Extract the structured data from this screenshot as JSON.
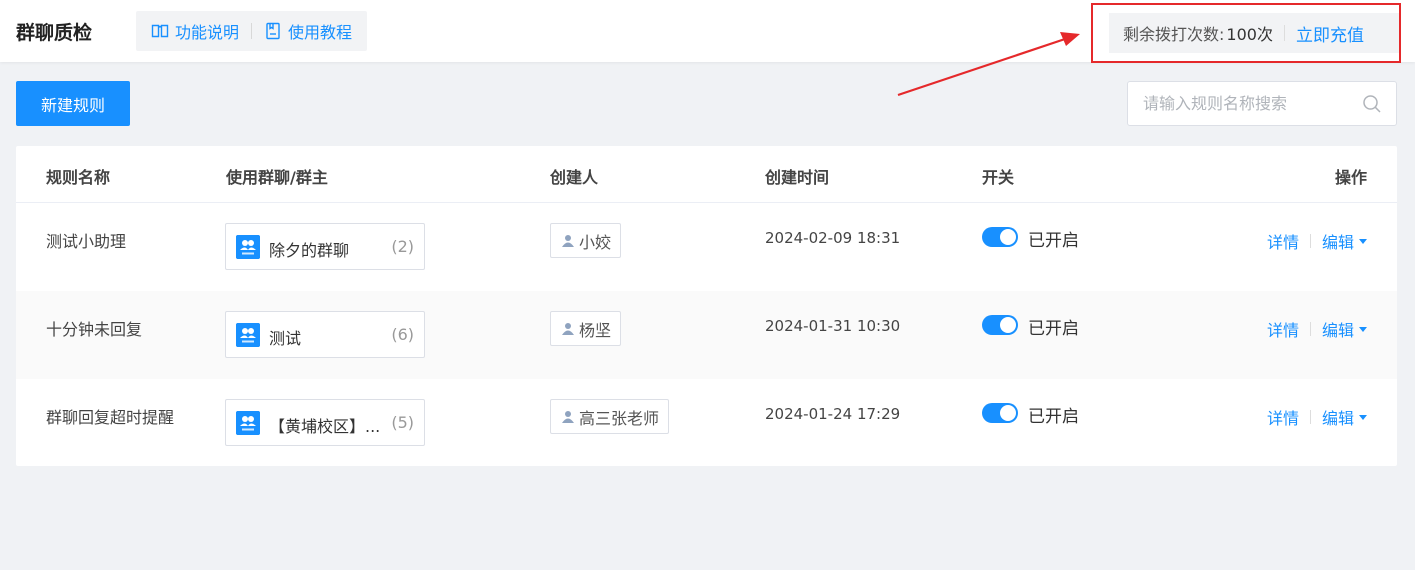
{
  "header": {
    "title": "群聊质检",
    "links": [
      {
        "label": "功能说明",
        "icon": "book-icon"
      },
      {
        "label": "使用教程",
        "icon": "document-icon"
      }
    ],
    "credits_label": "剩余拨打次数:",
    "credits_value": "100次",
    "recharge_label": "立即充值"
  },
  "toolbar": {
    "new_rule_label": "新建规则",
    "search_placeholder": "请输入规则名称搜索"
  },
  "table": {
    "columns": [
      "规则名称",
      "使用群聊/群主",
      "创建人",
      "创建时间",
      "开关",
      "操作"
    ],
    "rows": [
      {
        "name": "测试小助理",
        "group": "除夕的群聊",
        "group_count": "(2)",
        "creator": "小姣",
        "created": "2024-02-09 18:31",
        "status": "已开启",
        "enabled": true,
        "detail": "详情",
        "edit": "编辑"
      },
      {
        "name": "十分钟未回复",
        "group": "测试",
        "group_count": "(6)",
        "creator": "杨坚",
        "created": "2024-01-31 10:30",
        "status": "已开启",
        "enabled": true,
        "detail": "详情",
        "edit": "编辑"
      },
      {
        "name": "群聊回复超时提醒",
        "group": "【黄埔校区】...",
        "group_count": "(5)",
        "creator": "高三张老师",
        "created": "2024-01-24 17:29",
        "status": "已开启",
        "enabled": true,
        "detail": "详情",
        "edit": "编辑"
      }
    ]
  },
  "colors": {
    "accent": "#1890ff",
    "annotation": "#e5292b"
  }
}
